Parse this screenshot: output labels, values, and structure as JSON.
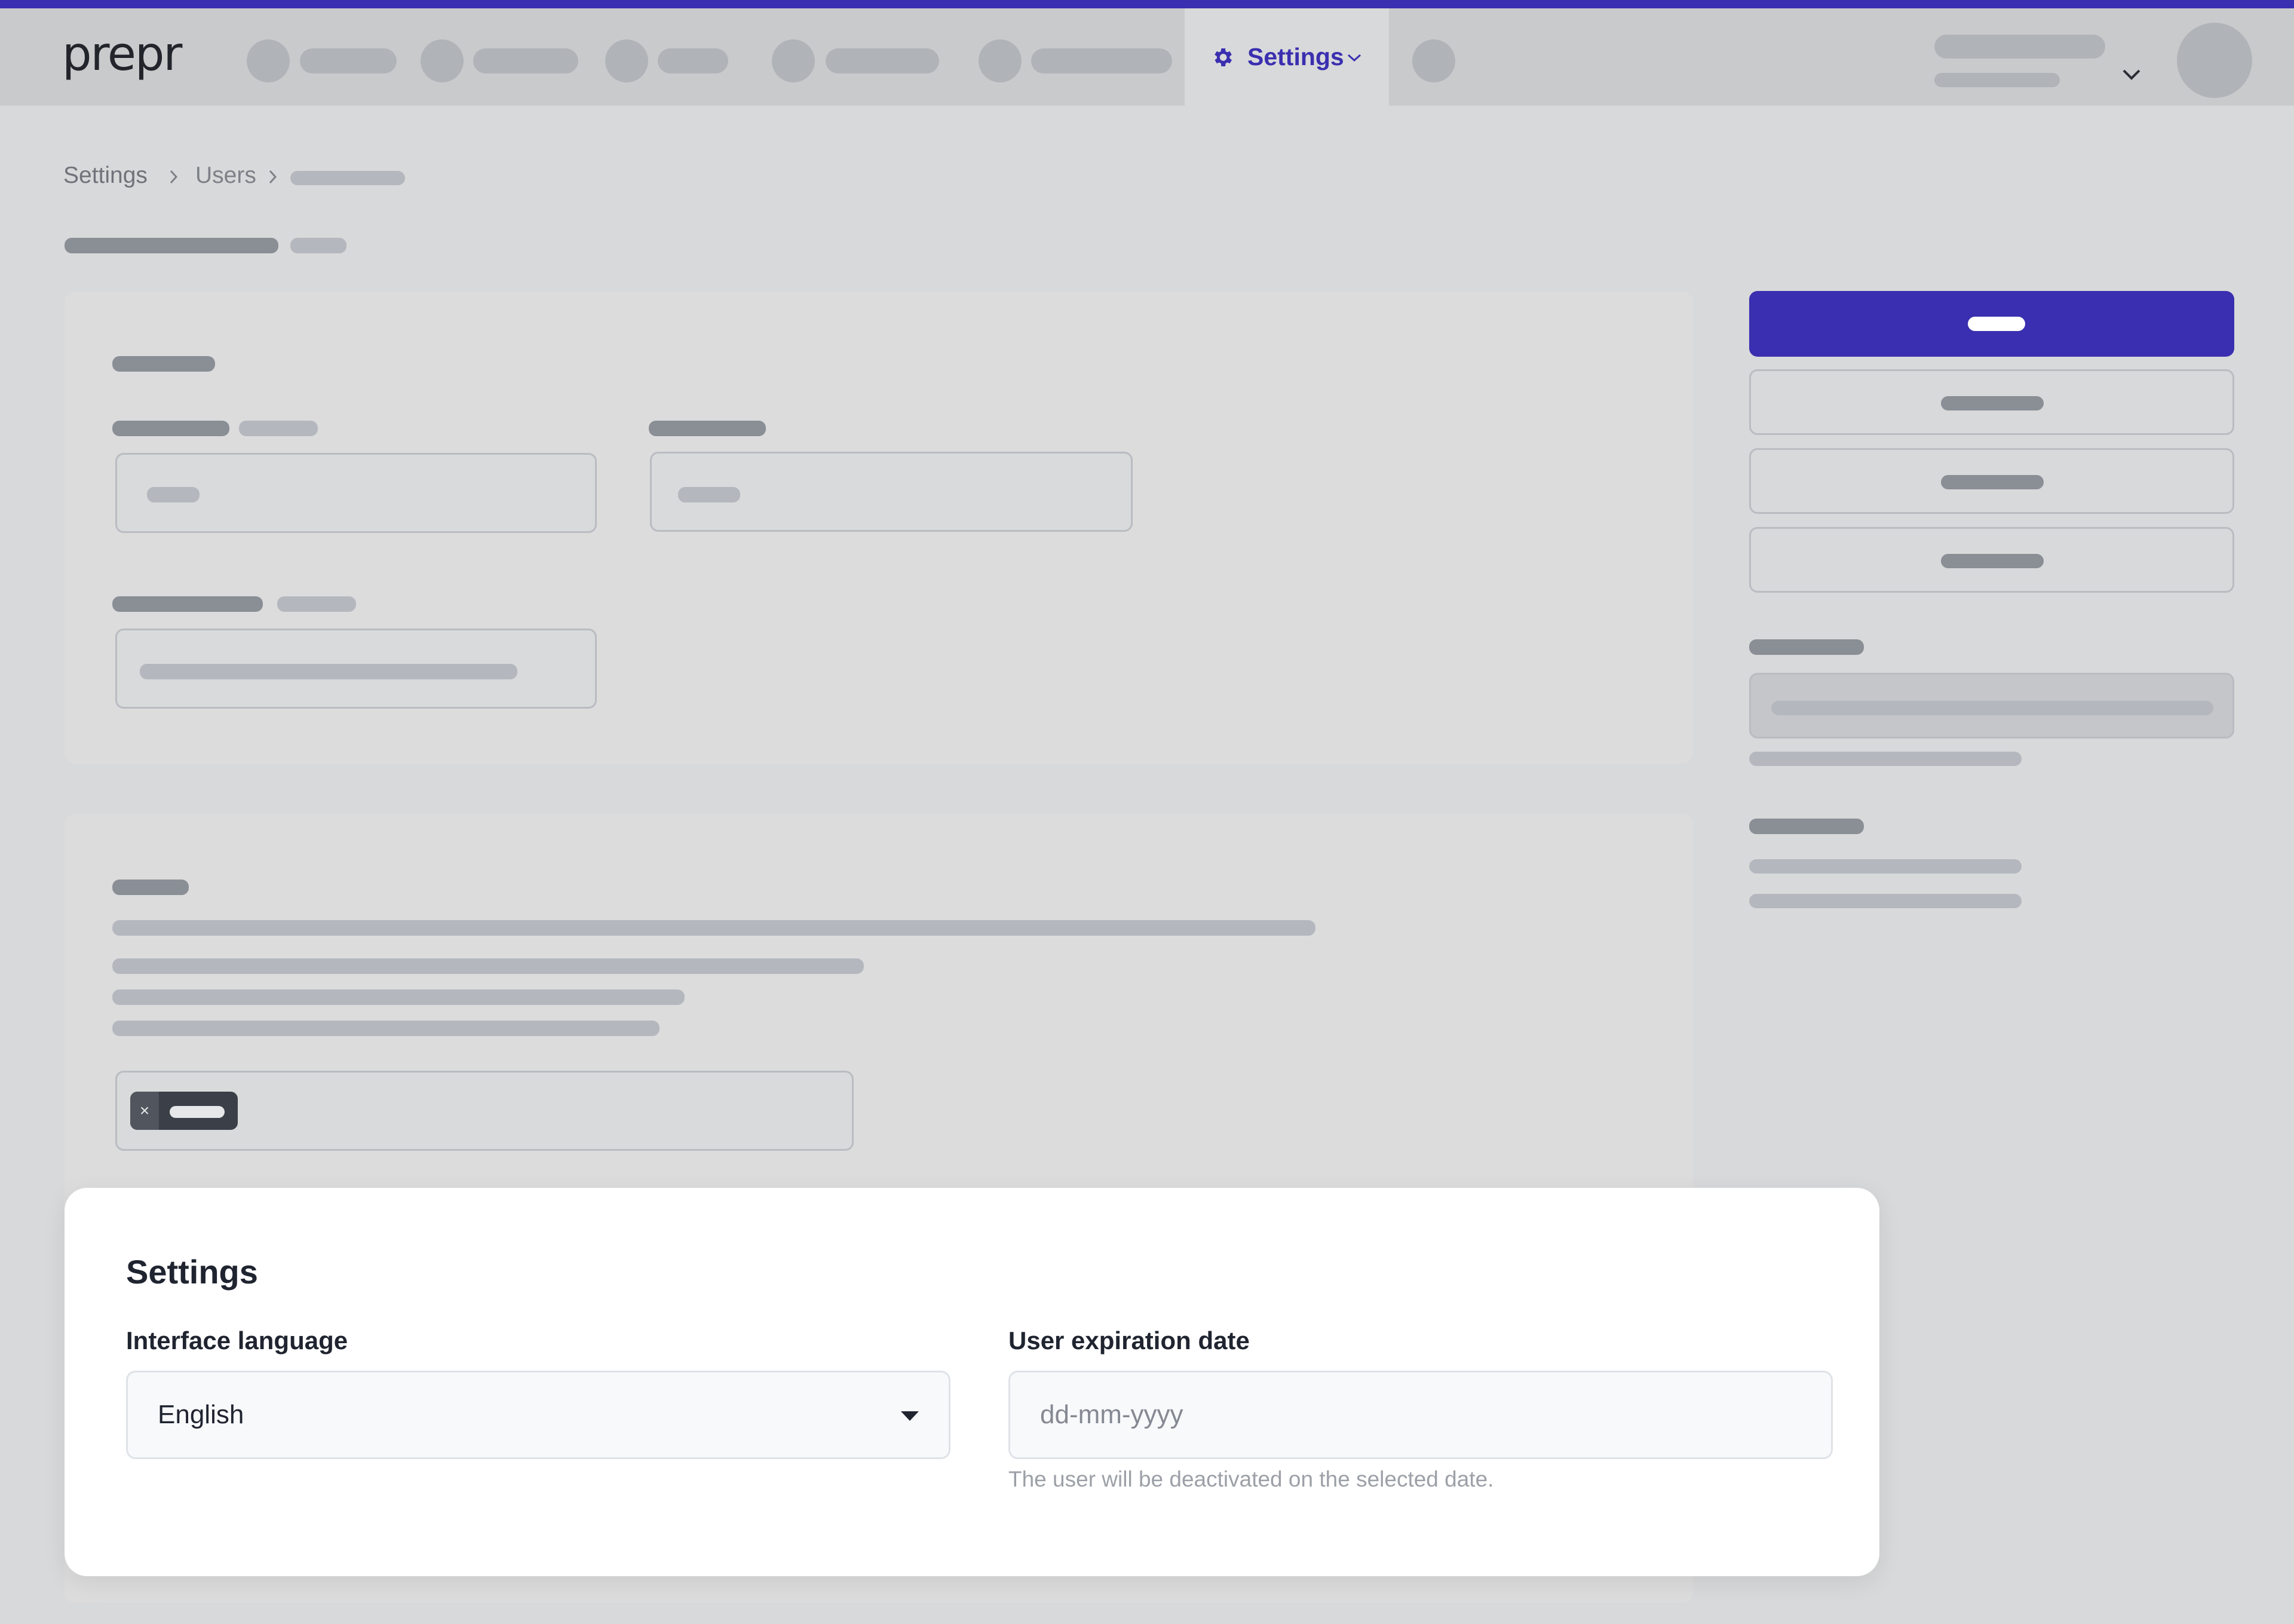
{
  "app": {
    "logo": "prepr",
    "accent_color": "#3a2fb0"
  },
  "topnav": {
    "active_tab_label": "Settings",
    "active_tab_icon": "gear-icon",
    "active_tab_dropdown_icon": "chevron-down-icon",
    "user_menu_icon": "chevron-down-icon"
  },
  "breadcrumb": {
    "items": [
      "Settings",
      "Users"
    ]
  },
  "modal": {
    "title": "Settings",
    "language": {
      "label": "Interface language",
      "value": "English"
    },
    "expiration": {
      "label": "User expiration date",
      "placeholder": "dd-mm-yyyy",
      "value": "",
      "help": "The user will be deactivated on the selected date."
    }
  }
}
